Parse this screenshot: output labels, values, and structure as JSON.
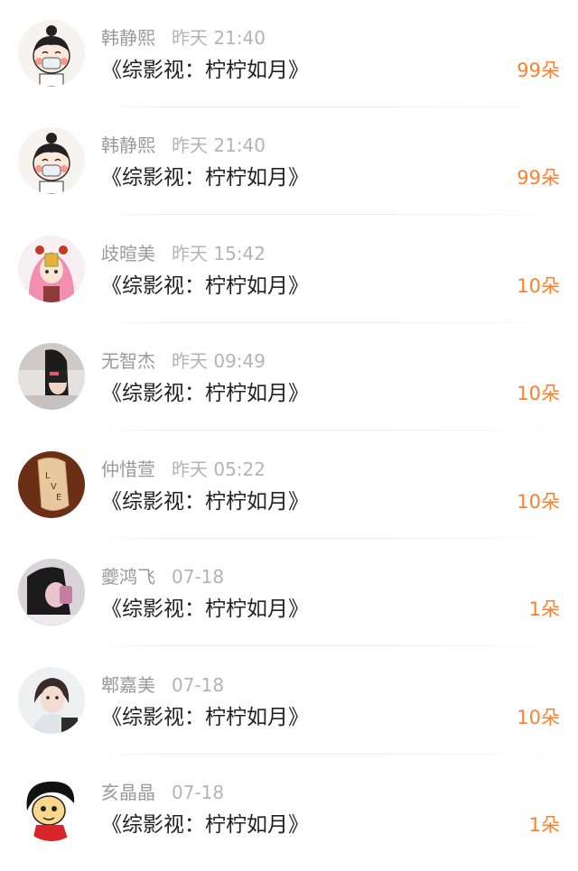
{
  "items": [
    {
      "name": "韩静熙",
      "time": "昨天 21:40",
      "title": "《综影视：柠柠如月》",
      "amount": "99朵",
      "avatar_icon": "cartoon-girl-mask-avatar"
    },
    {
      "name": "韩静熙",
      "time": "昨天 21:40",
      "title": "《综影视：柠柠如月》",
      "amount": "99朵",
      "avatar_icon": "cartoon-girl-mask-avatar"
    },
    {
      "name": "歧暄美",
      "time": "昨天 15:42",
      "title": "《综影视：柠柠如月》",
      "amount": "10朵",
      "avatar_icon": "pink-hair-anime-avatar"
    },
    {
      "name": "无智杰",
      "time": "昨天 09:49",
      "title": "《综影视：柠柠如月》",
      "amount": "10朵",
      "avatar_icon": "selfie-photo-avatar"
    },
    {
      "name": "仲惜萱",
      "time": "昨天 05:22",
      "title": "《综影视：柠柠如月》",
      "amount": "10朵",
      "avatar_icon": "love-paper-avatar"
    },
    {
      "name": "夔鸿飞",
      "time": "07-18",
      "title": "《综影视：柠柠如月》",
      "amount": "1朵",
      "avatar_icon": "dark-photo-avatar"
    },
    {
      "name": "郫嘉美",
      "time": "07-18",
      "title": "《综影视：柠柠如月》",
      "amount": "10朵",
      "avatar_icon": "girl-photo-avatar"
    },
    {
      "name": "亥晶晶",
      "time": "07-18",
      "title": "《综影视：柠柠如月》",
      "amount": "1朵",
      "avatar_icon": "cartoon-character-avatar"
    }
  ],
  "colors": {
    "accent": "#ff7f2a",
    "name": "#9a9a9a",
    "time": "#b4b4b4",
    "title": "#222222"
  }
}
